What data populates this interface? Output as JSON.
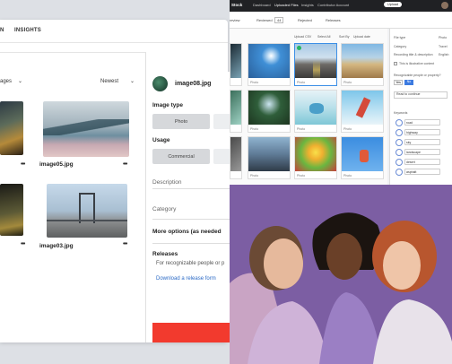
{
  "left_app": {
    "tabs": [
      {
        "label": "N"
      },
      {
        "label": "INSIGHTS"
      }
    ],
    "filter_label": "ages",
    "sort_label": "Newest",
    "files": [
      {
        "name": "image05.jpg"
      },
      {
        "name": "image03.jpg"
      }
    ],
    "more_label": "•••",
    "detail": {
      "filename": "image08.jpg",
      "image_type_label": "Image type",
      "image_type_option": "Photo",
      "usage_label": "Usage",
      "usage_option": "Commercial",
      "description_placeholder": "Description",
      "category_placeholder": "Category",
      "more_options": "More options (as needed",
      "releases_title": "Releases",
      "releases_text": "For recognizable people or p",
      "releases_link": "Download a release form"
    }
  },
  "right_app": {
    "brand": "Stock",
    "nav": [
      "Dashboard",
      "Uploaded Files",
      "Insights",
      "Contributor Account"
    ],
    "upload_button": "Upload",
    "subtabs": [
      "review",
      "Reviewed",
      "Rejected",
      "Releases"
    ],
    "subtab_count": "44",
    "toolbar": [
      "Upload CSV",
      "Select All",
      "Sort By",
      "Upload date"
    ],
    "panel": {
      "rows": [
        {
          "label": "File type",
          "value": "Photo"
        },
        {
          "label": "Category",
          "value": "Travel"
        },
        {
          "label": "Recording title & description",
          "value": "English"
        }
      ],
      "checkbox_label": "This is illustrative content",
      "question": "Recognizable people or property?",
      "yes": "Yes",
      "no": "No",
      "release": "Read to continue",
      "keywords_label": "Keywords",
      "keywords": [
        "road",
        "highway",
        "sky",
        "landscape",
        "desert",
        "asphalt"
      ]
    }
  },
  "colors": {
    "accent_red": "#f23a2e",
    "link_blue": "#2b6ac6",
    "dark_bar": "#202124",
    "photo_bg": "#7c5ea3"
  }
}
